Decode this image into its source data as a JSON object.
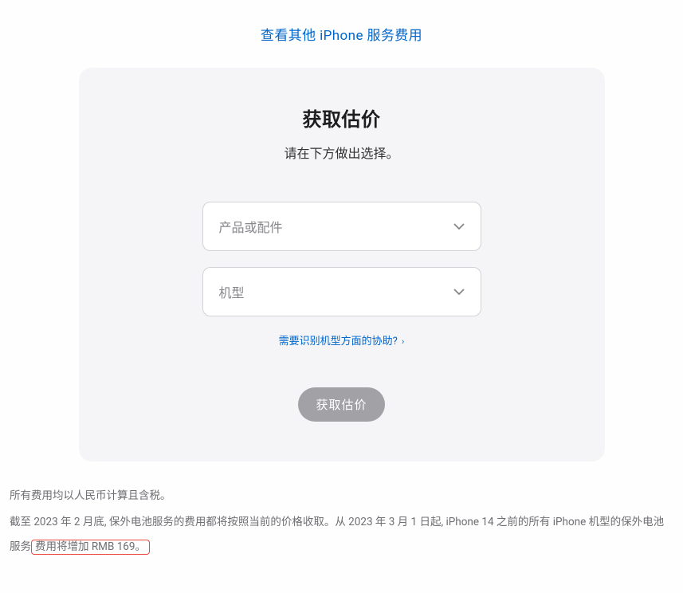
{
  "topLink": {
    "text": "查看其他 iPhone 服务费用"
  },
  "card": {
    "title": "获取估价",
    "subtitle": "请在下方做出选择。",
    "productSelect": {
      "placeholder": "产品或配件"
    },
    "modelSelect": {
      "placeholder": "机型"
    },
    "helpLink": {
      "text": "需要识别机型方面的协助?"
    },
    "submitButton": {
      "label": "获取估价"
    }
  },
  "footer": {
    "line1": "所有费用均以人民币计算且含税。",
    "line2_prefix": "截至 2023 年 2 月底, 保外电池服务的费用都将按照当前的价格收取。从 2023 年 3 月 1 日起, iPhone 14 之前的所有 iPhone 机型的保外电池服务",
    "line2_highlight": "费用将增加 RMB 169。"
  }
}
